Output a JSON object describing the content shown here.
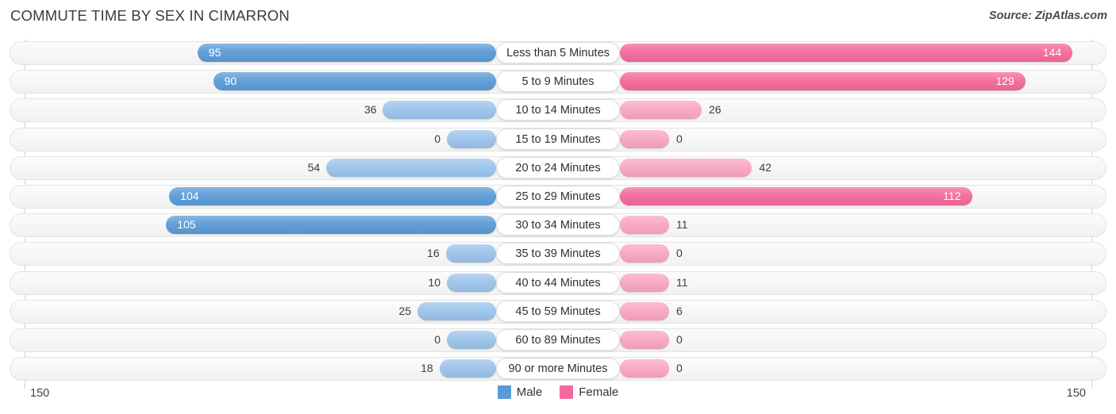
{
  "header": {
    "title": "COMMUTE TIME BY SEX IN CIMARRON",
    "source": "Source: ZipAtlas.com"
  },
  "axis": {
    "left_label": "150",
    "right_label": "150",
    "max": 150
  },
  "legend": {
    "items": [
      {
        "label": "Male",
        "color": "#5b9bd5"
      },
      {
        "label": "Female",
        "color": "#f4699b"
      }
    ]
  },
  "colors": {
    "male_strong": "#5b9bd5",
    "male_light": "#9cc3ea",
    "female_strong": "#f4699b",
    "female_light": "#f9a6c2",
    "track": "#f6f6f6",
    "track_border": "#e3e3e3",
    "gridline": "#d2d2d2"
  },
  "chart_data": {
    "type": "bar",
    "title": "COMMUTE TIME BY SEX IN CIMARRON",
    "subtitle": "Source: ZipAtlas.com",
    "orientation": "horizontal",
    "style": "diverging-bidirectional",
    "xlabel": "",
    "ylabel": "",
    "xlim": [
      150,
      150
    ],
    "grid": false,
    "legend_position": "bottom-center",
    "categories": [
      "Less than 5 Minutes",
      "5 to 9 Minutes",
      "10 to 14 Minutes",
      "15 to 19 Minutes",
      "20 to 24 Minutes",
      "25 to 29 Minutes",
      "30 to 34 Minutes",
      "35 to 39 Minutes",
      "40 to 44 Minutes",
      "45 to 59 Minutes",
      "60 to 89 Minutes",
      "90 or more Minutes"
    ],
    "series": [
      {
        "name": "Male",
        "color": "#5b9bd5",
        "direction": "left",
        "values": [
          95,
          90,
          36,
          0,
          54,
          104,
          105,
          16,
          10,
          25,
          0,
          18
        ]
      },
      {
        "name": "Female",
        "color": "#f4699b",
        "direction": "right",
        "values": [
          144,
          129,
          26,
          0,
          42,
          112,
          11,
          0,
          11,
          6,
          0,
          0
        ]
      }
    ]
  }
}
